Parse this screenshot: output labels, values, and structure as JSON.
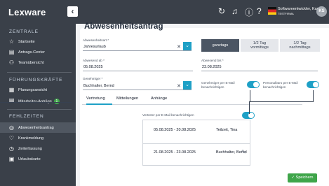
{
  "app": {
    "logo": "Lexware",
    "collapse_glyph": "‹",
    "user_name": "Softwareentwickler, Karsten",
    "user_company": "TESTFIRMA",
    "user_initials": "KS"
  },
  "topbar_icons": [
    "refresh-icon",
    "bell-icon",
    "info-icon",
    "help-icon",
    "flag-icon"
  ],
  "sidebar": {
    "sections": [
      {
        "title": "ZENTRALE",
        "items": [
          {
            "label": "Startseite",
            "icon": "☆"
          },
          {
            "label": "Antrags-Center",
            "icon": "▤"
          },
          {
            "label": "Teamübersicht",
            "icon": "⚇"
          }
        ]
      },
      {
        "title": "FÜHRUNGSKRÄFTE",
        "items": [
          {
            "label": "Planungsansicht",
            "icon": "▦"
          },
          {
            "label": "Mitarbeiter-Anträge",
            "icon": "▤",
            "badge": "1"
          }
        ]
      },
      {
        "title": "FEHLZEITEN",
        "items": [
          {
            "label": "Abwesenheitsantrag",
            "icon": "◎"
          },
          {
            "label": "Krankmeldung",
            "icon": "♡"
          },
          {
            "label": "Zeiterfassung",
            "icon": "◷"
          },
          {
            "label": "Urlaubskarte",
            "icon": "▣"
          }
        ]
      }
    ]
  },
  "form": {
    "title": "Abwesenheitsantrag",
    "type_label": "Abwesenheitsart *",
    "type_value": "Jahresurlaub",
    "from_label": "Abwesend ab *",
    "from_value": "05.08.2025",
    "to_label": "Abwesend bis *",
    "to_value": "23.08.2025",
    "approver_label": "Genehmiger *",
    "approver_value": "Buchhalter, Bernd",
    "segments": [
      {
        "label": "ganztags",
        "active": true
      },
      {
        "label": "1/2 Tag\nvormittags",
        "active": false
      },
      {
        "label": "1/2 Tag\nnachmittags",
        "active": false
      }
    ],
    "notify_approver": "Genehmiger per E-Mail\nbenachrichtigen",
    "notify_hr": "Personalbüro per E-Mail\nbenachrichtigen"
  },
  "tabs": [
    "Vertretung",
    "Mitteilungen",
    "Anhänge"
  ],
  "substitute": {
    "notify_label": "Vertreter per E-Mail benachrichtigen",
    "rows": [
      {
        "dates": "05.08.2025 - 20.08.2025",
        "name": "Teilzeit, Tina"
      },
      {
        "dates": "21.08.2025 - 23.08.2025",
        "name": "Buchhalter, Bernd"
      }
    ]
  },
  "save_label": "Speichern",
  "colors": {
    "accent": "#1ea0c6",
    "sidebar": "#3a4049",
    "success": "#3fa54a"
  }
}
